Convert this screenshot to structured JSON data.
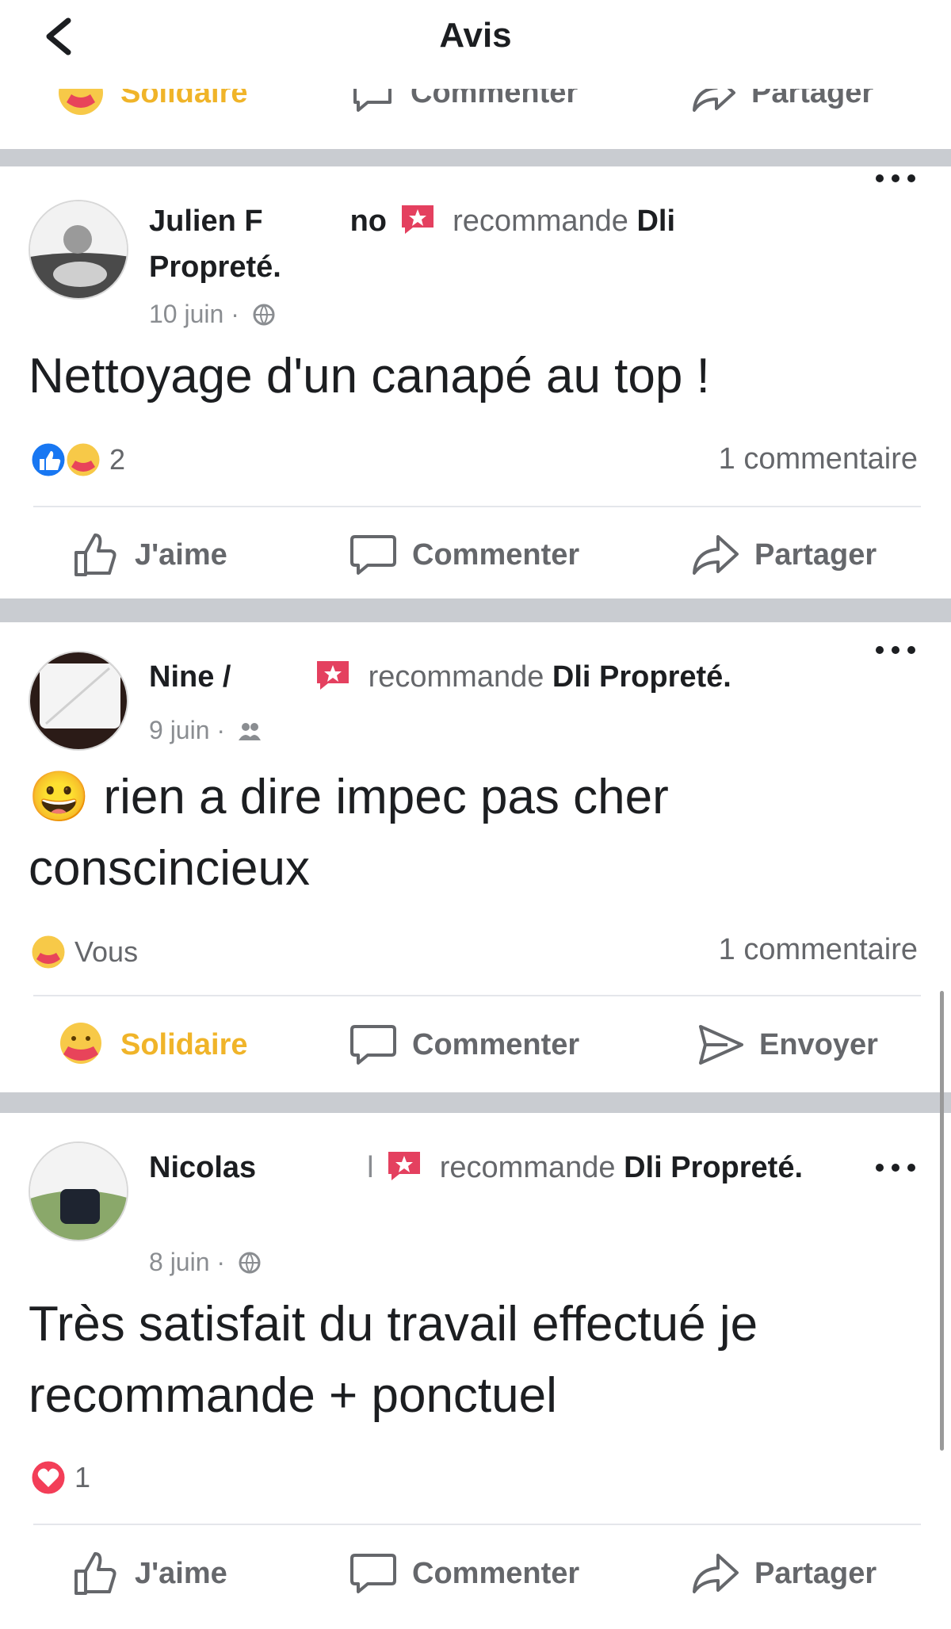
{
  "header": {
    "title": "Avis"
  },
  "top_clipped_actions": {
    "react": "Solidaire",
    "comment": "Commenter",
    "share": "Partager"
  },
  "posts": [
    {
      "author": "Julien F",
      "author_tail": "no",
      "verb": "recommande",
      "page": "Dli Propreté.",
      "date": "10 juin",
      "privacy_icon": "globe-icon",
      "text": "Nettoyage d'un canapé au top !",
      "reactions": [
        "like-icon",
        "care-icon"
      ],
      "reaction_count": "2",
      "comments": "1 commentaire",
      "actions": {
        "react": "J'aime",
        "comment": "Commenter",
        "share": "Partager"
      }
    },
    {
      "author": "Nine /",
      "verb": "recommande",
      "page": "Dli Propreté.",
      "date": "9 juin",
      "privacy_icon": "friends-icon",
      "emoji": "😀",
      "text": "rien a dire impec pas cher conscincieux",
      "reactions": [
        "care-icon"
      ],
      "reaction_count": "Vous",
      "comments": "1 commentaire",
      "actions": {
        "react": "Solidaire",
        "comment": "Commenter",
        "share": "Envoyer"
      }
    },
    {
      "author": "Nicolas",
      "author_tail": "l",
      "verb": "recommande",
      "page": "Dli Propreté.",
      "date": "8 juin",
      "privacy_icon": "globe-icon",
      "text": "Très satisfait du travail effectué je recommande + ponctuel",
      "reactions": [
        "love-icon"
      ],
      "reaction_count": "1",
      "comments": "",
      "actions": {
        "react": "J'aime",
        "comment": "Commenter",
        "share": "Partager"
      }
    }
  ],
  "colors": {
    "accent_reaction": "#f0b429",
    "recommend_badge": "#e4405f",
    "like_blue": "#1877f2",
    "love_red": "#f33e58"
  }
}
